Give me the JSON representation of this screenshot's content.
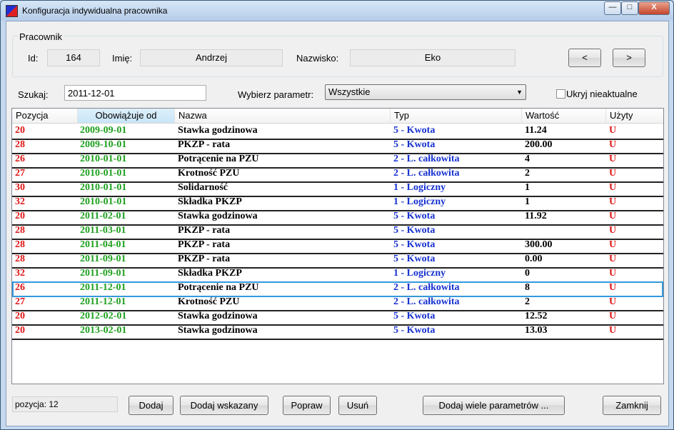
{
  "window": {
    "title": "Konfiguracja indywidualna pracownika",
    "controls": {
      "minimize": "—",
      "maximize": "□",
      "close": "X"
    }
  },
  "employee": {
    "group_title": "Pracownik",
    "id_label": "Id:",
    "id_value": "164",
    "first_name_label": "Imię:",
    "first_name_value": "Andrzej",
    "last_name_label": "Nazwisko:",
    "last_name_value": "Eko",
    "prev_label": "<",
    "next_label": ">"
  },
  "filters": {
    "search_label": "Szukaj:",
    "search_value": "2011-12-01",
    "param_label": "Wybierz parametr:",
    "param_value": "Wszystkie",
    "hide_label": "Ukryj nieaktualne",
    "hide_checked": false
  },
  "table": {
    "columns": [
      "Pozycja",
      "Obowiązuje od",
      "Nazwa",
      "Typ",
      "Wartość",
      "Użyty"
    ],
    "selected_row": 11,
    "rows": [
      {
        "poz": "20",
        "date": "2009-09-01",
        "name": "Stawka godzinowa",
        "typ": "5 - Kwota",
        "val": "11.24",
        "used": "U"
      },
      {
        "poz": "28",
        "date": "2009-10-01",
        "name": "PKZP - rata",
        "typ": "5 - Kwota",
        "val": "200.00",
        "used": "U"
      },
      {
        "poz": "26",
        "date": "2010-01-01",
        "name": "Potrącenie na PZU",
        "typ": "2 - L. całkowita",
        "val": "4",
        "used": "U"
      },
      {
        "poz": "27",
        "date": "2010-01-01",
        "name": "Krotność PZU",
        "typ": "2 - L. całkowita",
        "val": "2",
        "used": "U"
      },
      {
        "poz": "30",
        "date": "2010-01-01",
        "name": "Solidarność",
        "typ": "1 - Logiczny",
        "val": "1",
        "used": "U"
      },
      {
        "poz": "32",
        "date": "2010-01-01",
        "name": "Składka PKZP",
        "typ": "1 - Logiczny",
        "val": "1",
        "used": "U"
      },
      {
        "poz": "20",
        "date": "2011-02-01",
        "name": "Stawka godzinowa",
        "typ": "5 - Kwota",
        "val": "11.92",
        "used": "U"
      },
      {
        "poz": "28",
        "date": "2011-03-01",
        "name": "PKZP - rata",
        "typ": "5 - Kwota",
        "val": "",
        "used": "U"
      },
      {
        "poz": "28",
        "date": "2011-04-01",
        "name": "PKZP - rata",
        "typ": "5 - Kwota",
        "val": "300.00",
        "used": "U"
      },
      {
        "poz": "28",
        "date": "2011-09-01",
        "name": "PKZP - rata",
        "typ": "5 - Kwota",
        "val": "0.00",
        "used": "U"
      },
      {
        "poz": "32",
        "date": "2011-09-01",
        "name": "Składka PKZP",
        "typ": "1 - Logiczny",
        "val": "0",
        "used": "U"
      },
      {
        "poz": "26",
        "date": "2011-12-01",
        "name": "Potrącenie na PZU",
        "typ": "2 - L. całkowita",
        "val": "8",
        "used": "U"
      },
      {
        "poz": "27",
        "date": "2011-12-01",
        "name": "Krotność PZU",
        "typ": "2 - L. całkowita",
        "val": "2",
        "used": "U"
      },
      {
        "poz": "20",
        "date": "2012-02-01",
        "name": "Stawka godzinowa",
        "typ": "5 - Kwota",
        "val": "12.52",
        "used": "U"
      },
      {
        "poz": "20",
        "date": "2013-02-01",
        "name": "Stawka godzinowa",
        "typ": "5 - Kwota",
        "val": "13.03",
        "used": "U"
      }
    ]
  },
  "footer": {
    "status": "pozycja:  12",
    "add": "Dodaj",
    "add_selected": "Dodaj wskazany",
    "edit": "Popraw",
    "delete": "Usuń",
    "add_many": "Dodaj wiele parametrów ...",
    "close": "Zamknij"
  },
  "colors": {
    "position": "#e01515",
    "date": "#1ea01e",
    "type": "#1530d0",
    "used": "#e01515",
    "selection": "#3399dd"
  }
}
